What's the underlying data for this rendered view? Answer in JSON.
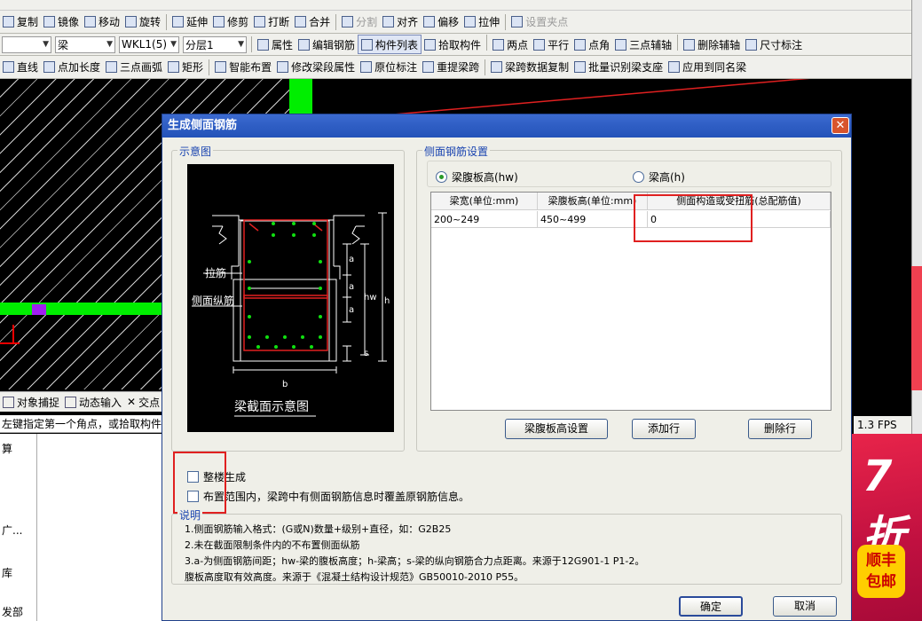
{
  "toolbar1": [
    {
      "icon": "copy-icon",
      "label": "复制"
    },
    {
      "icon": "mirror-icon",
      "label": "镜像"
    },
    {
      "icon": "move-icon",
      "label": "移动"
    },
    {
      "icon": "rotate-icon",
      "label": "旋转"
    },
    {
      "icon": "extend-icon",
      "label": "延伸"
    },
    {
      "icon": "trim-icon",
      "label": "修剪"
    },
    {
      "icon": "break-icon",
      "label": "打断"
    },
    {
      "icon": "merge-icon",
      "label": "合并"
    },
    {
      "icon": "split-icon",
      "label": "分割",
      "disabled": true
    },
    {
      "icon": "align-icon",
      "label": "对齐"
    },
    {
      "icon": "offset-icon",
      "label": "偏移"
    },
    {
      "icon": "stretch-icon",
      "label": "拉伸"
    },
    {
      "icon": "grip-icon",
      "label": "设置夹点",
      "disabled": true
    }
  ],
  "toolbar2": {
    "type_select": "梁",
    "element_select": "WKL1(5)",
    "layer_select": "分层1",
    "buttons": [
      {
        "icon": "property-icon",
        "label": "属性"
      },
      {
        "icon": "edit-rebar-icon",
        "label": "编辑钢筋"
      },
      {
        "icon": "list-icon",
        "label": "构件列表",
        "pressed": true
      },
      {
        "icon": "pick-icon",
        "label": "拾取构件"
      },
      {
        "icon": "two-point-icon",
        "label": "两点"
      },
      {
        "icon": "parallel-icon",
        "label": "平行"
      },
      {
        "icon": "point-angle-icon",
        "label": "点角"
      },
      {
        "icon": "three-point-aux-icon",
        "label": "三点辅轴"
      },
      {
        "icon": "delete-aux-icon",
        "label": "删除辅轴"
      },
      {
        "icon": "dimension-icon",
        "label": "尺寸标注"
      }
    ]
  },
  "toolbar3": [
    {
      "icon": "line-icon",
      "label": "直线"
    },
    {
      "icon": "point-length-icon",
      "label": "点加长度"
    },
    {
      "icon": "arc-icon",
      "label": "三点画弧"
    },
    {
      "icon": "rect-icon",
      "label": "矩形"
    },
    {
      "icon": "smart-layout-icon",
      "label": "智能布置"
    },
    {
      "icon": "modify-span-icon",
      "label": "修改梁段属性"
    },
    {
      "icon": "in-situ-label-icon",
      "label": "原位标注"
    },
    {
      "icon": "re-extract-span-icon",
      "label": "重提梁跨"
    },
    {
      "icon": "copy-span-data-icon",
      "label": "梁跨数据复制"
    },
    {
      "icon": "batch-identify-icon",
      "label": "批量识别梁支座"
    },
    {
      "icon": "apply-same-icon",
      "label": "应用到同名梁"
    }
  ],
  "snapbar": {
    "snap": "对象捕捉",
    "dynamic": "动态输入",
    "intersect": "交点"
  },
  "prompt": "左键指定第一个角点，或拾取构件",
  "fps": "1.3 FPS",
  "lower_left": [
    "算",
    "广...",
    "库",
    "发部"
  ],
  "ad": {
    "big": "7折",
    "badge_line1": "顺丰",
    "badge_line2": "包邮"
  },
  "dialog": {
    "title": "生成侧面钢筋",
    "sketch_group": "示意图",
    "sketch": {
      "label_tie": "拉筋",
      "label_side": "侧面纵筋",
      "label_a": "a",
      "label_hw": "hw",
      "label_h": "h",
      "label_s": "s",
      "label_b": "b",
      "caption": "梁截面示意图"
    },
    "settings_group": "侧面钢筋设置",
    "radio_hw": "梁腹板高(hw)",
    "radio_h": "梁高(h)",
    "table": {
      "headers": [
        "梁宽(单位:mm)",
        "梁腹板高(单位:mm)",
        "侧面构造或受扭筋(总配筋值)"
      ],
      "rows": [
        [
          "200~249",
          "450~499",
          "0"
        ]
      ]
    },
    "btn_web_height": "梁腹板高设置",
    "btn_add_row": "添加行",
    "btn_delete_row": "删除行",
    "chk_whole_floor": "整楼生成",
    "chk_overwrite": "布置范围内，梁跨中有侧面钢筋信息时覆盖原钢筋信息。",
    "notes_title": "说明",
    "notes": [
      "1.侧面钢筋输入格式：(G或N)数量+级别+直径，如：G2B25",
      "2.未在截面限制条件内的不布置侧面纵筋",
      "3.a-为侧面钢筋间距；hw-梁的腹板高度；h-梁高；s-梁的纵向钢筋合力点距离。来源于12G901-1 P1-2。",
      "  腹板高度取有效高度。来源于《混凝土结构设计规范》GB50010-2010 P55。"
    ],
    "ok": "确定",
    "cancel": "取消"
  }
}
